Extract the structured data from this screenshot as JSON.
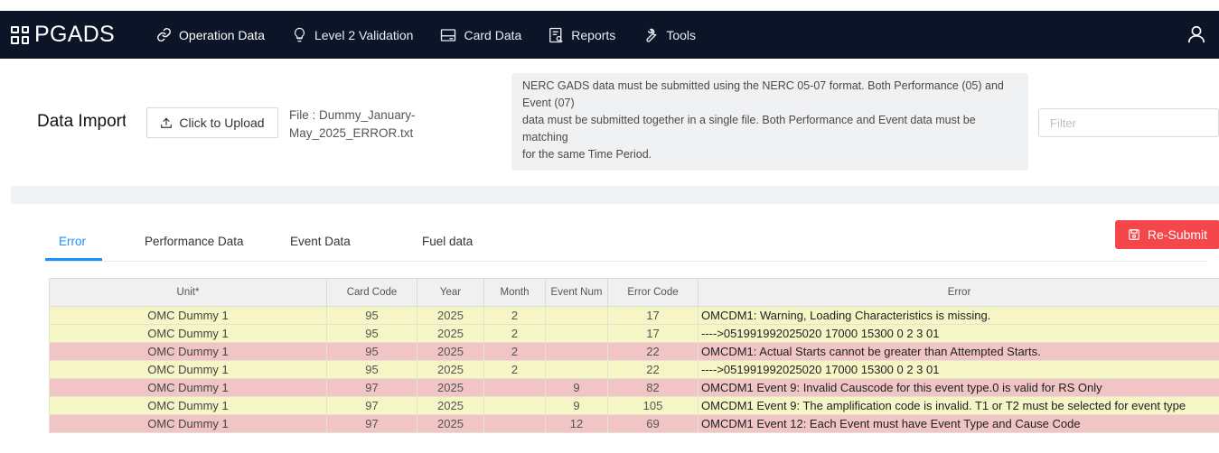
{
  "nav": {
    "brand": "PGADS",
    "items": [
      {
        "label": "Operation Data",
        "icon": "link-icon",
        "active": true
      },
      {
        "label": "Level 2 Validation",
        "icon": "lightbulb-icon",
        "active": false
      },
      {
        "label": "Card Data",
        "icon": "card-icon",
        "active": false
      },
      {
        "label": "Reports",
        "icon": "report-icon",
        "active": false
      },
      {
        "label": "Tools",
        "icon": "wrench-icon",
        "active": false
      }
    ],
    "user_icon": "user-icon"
  },
  "import": {
    "title": "Data Import",
    "upload_label": "Click to Upload",
    "file_text": "File : Dummy_January-May_2025_ERROR.txt",
    "info_lines": [
      "NERC GADS data must be submitted using the NERC 05-07 format. Both Performance (05) and Event (07)",
      "data must be submitted together in a single file. Both Performance and Event data must be matching",
      "for the same Time Period."
    ],
    "filter_placeholder": "Filter"
  },
  "tabs": [
    {
      "label": "Error",
      "active": true
    },
    {
      "label": "Performance Data",
      "active": false
    },
    {
      "label": "Event Data",
      "active": false
    },
    {
      "label": "Fuel data",
      "active": false
    }
  ],
  "resubmit_label": "Re-Submit",
  "colors": {
    "nav_bg": "#0c1428",
    "accent": "#1890ff",
    "resubmit": "#f5474b",
    "warn_row": "#f5f5c6",
    "error_row": "#f1c4c6"
  },
  "table": {
    "headers": [
      "Unit*",
      "Card Code",
      "Year",
      "Month",
      "Event Num",
      "Error Code",
      "Error"
    ],
    "rows": [
      {
        "status": "warn",
        "unit": "OMC Dummy 1",
        "card": "95",
        "year": "2025",
        "month": "2",
        "event": "",
        "code": "17",
        "error": "OMCDM1: Warning, Loading Characteristics is missing."
      },
      {
        "status": "warn",
        "unit": "OMC Dummy 1",
        "card": "95",
        "year": "2025",
        "month": "2",
        "event": "",
        "code": "17",
        "error": "---->051991992025020 17000 15300 0 2 3 01"
      },
      {
        "status": "bad",
        "unit": "OMC Dummy 1",
        "card": "95",
        "year": "2025",
        "month": "2",
        "event": "",
        "code": "22",
        "error": "OMCDM1: Actual Starts cannot be greater than Attempted Starts."
      },
      {
        "status": "warn",
        "unit": "OMC Dummy 1",
        "card": "95",
        "year": "2025",
        "month": "2",
        "event": "",
        "code": "22",
        "error": "---->051991992025020 17000 15300 0 2 3 01"
      },
      {
        "status": "bad",
        "unit": "OMC Dummy 1",
        "card": "97",
        "year": "2025",
        "month": "",
        "event": "9",
        "code": "82",
        "error": "OMCDM1 Event 9: Invalid Causcode for this event type.0 is valid for RS Only"
      },
      {
        "status": "warn",
        "unit": "OMC Dummy 1",
        "card": "97",
        "year": "2025",
        "month": "",
        "event": "9",
        "code": "105",
        "error": "OMCDM1 Event 9: The amplification code is invalid. T1 or T2 must be selected for event type"
      },
      {
        "status": "bad",
        "unit": "OMC Dummy 1",
        "card": "97",
        "year": "2025",
        "month": "",
        "event": "12",
        "code": "69",
        "error": "OMCDM1 Event 12: Each Event must have Event Type and Cause Code"
      }
    ]
  }
}
